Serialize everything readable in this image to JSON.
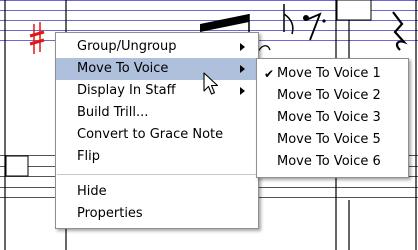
{
  "context_menu": {
    "items": [
      {
        "label": "Group/Ungroup",
        "submenu": true
      },
      {
        "label": "Move To Voice",
        "submenu": true,
        "highlighted": true
      },
      {
        "label": "Display In Staff",
        "submenu": true
      },
      {
        "label": "Build Trill...",
        "submenu": false
      },
      {
        "label": "Convert to Grace Note",
        "submenu": false
      },
      {
        "label": "Flip",
        "submenu": false
      }
    ],
    "bottom_items": [
      {
        "label": "Hide"
      },
      {
        "label": "Properties"
      }
    ]
  },
  "voice_submenu": {
    "items": [
      {
        "label": "Move To Voice 1",
        "checked": true
      },
      {
        "label": "Move To Voice 2",
        "checked": false
      },
      {
        "label": "Move To Voice 3",
        "checked": false
      },
      {
        "label": "Move To Voice 5",
        "checked": false
      },
      {
        "label": "Move To Voice 6",
        "checked": false
      }
    ]
  },
  "colors": {
    "staff_line": "#6b6bd0",
    "sharp": "#e01818",
    "highlight": "#aec0dc"
  }
}
